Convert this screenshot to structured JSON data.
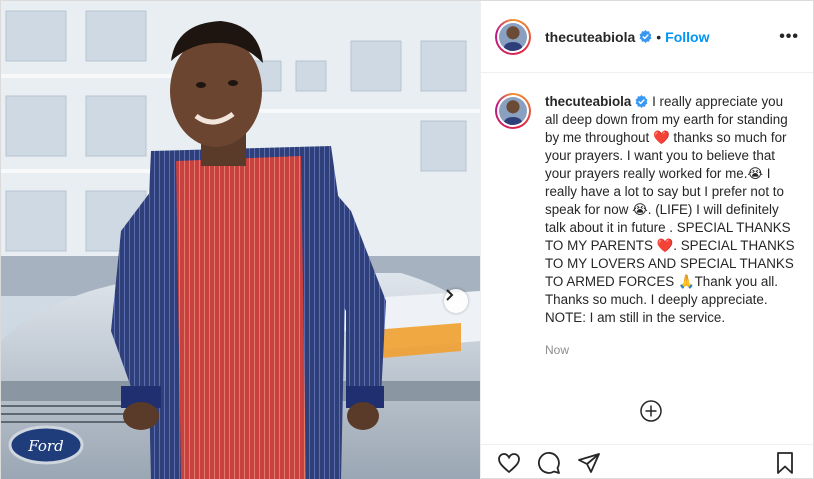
{
  "header": {
    "username": "thecuteabiola",
    "separator": "•",
    "follow_label": "Follow",
    "more_label": "•••"
  },
  "caption": {
    "username": "thecuteabiola",
    "segments": [
      {
        "type": "text",
        "value": "I really appreciate you all deep down from my earth for standing by me throughout "
      },
      {
        "type": "emoji",
        "value": "❤️"
      },
      {
        "type": "text",
        "value": " thanks so much for your prayers. I want you to believe that your prayers really worked for me."
      },
      {
        "type": "emoji",
        "value": "😭"
      },
      {
        "type": "text",
        "value": " I really have a lot to say but I prefer not to speak for now "
      },
      {
        "type": "emoji",
        "value": "😭"
      },
      {
        "type": "text",
        "value": ". (LIFE) I will definitely talk about it in future . SPECIAL THANKS TO MY PARENTS "
      },
      {
        "type": "emoji",
        "value": "❤️"
      },
      {
        "type": "text",
        "value": ". SPECIAL THANKS TO MY LOVERS AND SPECIAL THANKS TO ARMED FORCES "
      },
      {
        "type": "emoji",
        "value": "🙏"
      },
      {
        "type": "text",
        "value": "Thank you all. Thanks so much. I deeply appreciate. NOTE: I am still in the service."
      }
    ],
    "time": "Now"
  },
  "icons": {
    "next": "chevron-right-icon",
    "verified": "verified-badge-icon",
    "load_more": "plus-circle-icon",
    "like": "heart-icon",
    "comment": "comment-icon",
    "share": "send-icon",
    "save": "bookmark-icon"
  },
  "colors": {
    "accent": "#0095f6",
    "heart": "#e0245e",
    "text": "#262626",
    "muted": "#8e8e8e"
  }
}
